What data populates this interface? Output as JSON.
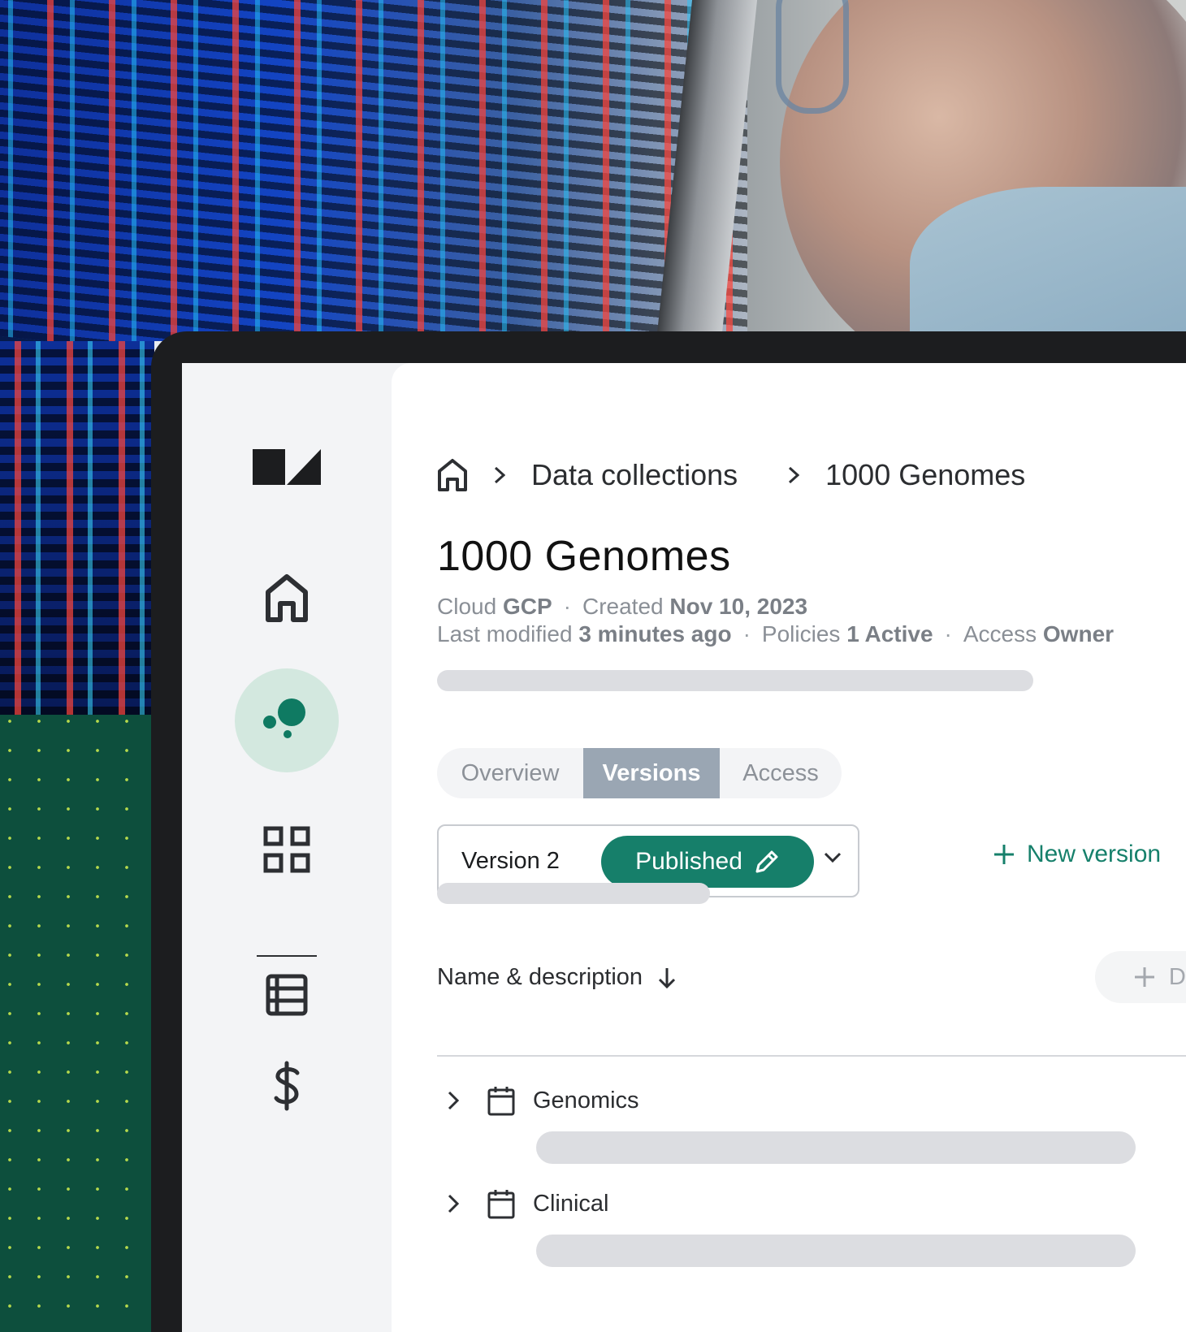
{
  "breadcrumb": {
    "items": [
      "Data collections",
      "1000 Genomes"
    ]
  },
  "page": {
    "title": "1000 Genomes"
  },
  "meta": {
    "cloud_label": "Cloud",
    "cloud_value": "GCP",
    "created_label": "Created",
    "created_value": "Nov 10, 2023",
    "modified_label": "Last modified",
    "modified_value": "3 minutes ago",
    "policies_label": "Policies",
    "policies_value": "1 Active",
    "access_label": "Access",
    "access_value": "Owner"
  },
  "tabs": [
    {
      "label": "Overview",
      "active": false
    },
    {
      "label": "Versions",
      "active": true
    },
    {
      "label": "Access",
      "active": false
    }
  ],
  "version_select": {
    "label": "Version 2",
    "status": "Published"
  },
  "actions": {
    "new_version": "New version",
    "data_resource": "Data resource"
  },
  "table": {
    "sort_label": "Name & description",
    "rows": [
      {
        "label": "Genomics"
      },
      {
        "label": "Clinical"
      }
    ]
  },
  "sidebar": {
    "items": [
      "logo",
      "home",
      "data-collections",
      "apps",
      "tables",
      "billing"
    ]
  },
  "colors": {
    "accent": "#167f6a",
    "active_tab": "#9aa6b3",
    "sidebar_active": "#d3e8df",
    "skeleton": "#dcdde1",
    "green_panel": "#0d4f3d"
  }
}
